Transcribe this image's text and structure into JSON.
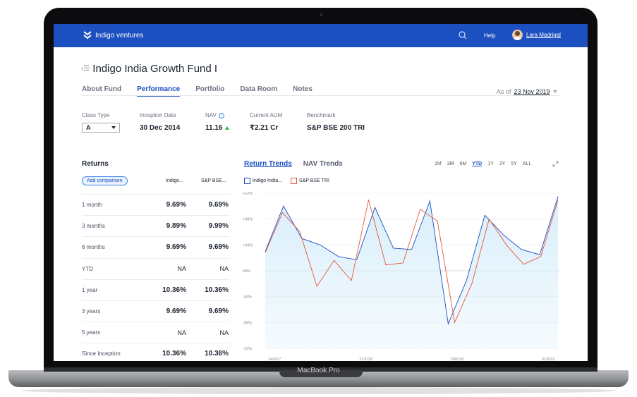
{
  "device": {
    "label": "MacBook Pro"
  },
  "topbar": {
    "brand": "Indigo ventures",
    "help": "Help",
    "user_name": "Lara Madrigal"
  },
  "page": {
    "title": "Indigo India Growth Fund I"
  },
  "tabs": [
    {
      "label": "About Fund",
      "active": false
    },
    {
      "label": "Performance",
      "active": true
    },
    {
      "label": "Portfolio",
      "active": false
    },
    {
      "label": "Data Room",
      "active": false
    },
    {
      "label": "Notes",
      "active": false
    }
  ],
  "as_of": {
    "label": "As of",
    "date": "23 Nov 2019"
  },
  "facts": {
    "class_type": {
      "label": "Class Type",
      "value": "A"
    },
    "inception": {
      "label": "Inception Date",
      "value": "30 Dec 2014"
    },
    "nav": {
      "label": "NAV",
      "value": "11.16"
    },
    "aum": {
      "label": "Current AUM",
      "value": "₹2.21 Cr"
    },
    "benchmark": {
      "label": "Benchmark",
      "value": "S&P BSE 200 TRI"
    }
  },
  "returns": {
    "title": "Returns",
    "add_comparison": "Add comparison",
    "columns": [
      "Indigo...",
      "S&P BSE..."
    ],
    "rows": [
      {
        "period": "1 month",
        "fund": "9.69%",
        "bench": "9.69%"
      },
      {
        "period": "3 months",
        "fund": "9.89%",
        "bench": "9.99%"
      },
      {
        "period": "6 months",
        "fund": "9.69%",
        "bench": "9.69%"
      },
      {
        "period": "YTD",
        "fund": "NA",
        "bench": "NA"
      },
      {
        "period": "1 year",
        "fund": "10.36%",
        "bench": "10.36%"
      },
      {
        "period": "3 years",
        "fund": "9.69%",
        "bench": "9.69%"
      },
      {
        "period": "5 years",
        "fund": "NA",
        "bench": "NA"
      },
      {
        "period": "Since Inception",
        "fund": "10.36%",
        "bench": "10.36%"
      }
    ]
  },
  "chart_tabs": [
    {
      "label": "Return Trends",
      "active": true
    },
    {
      "label": "NAV Trends",
      "active": false
    }
  ],
  "ranges": [
    "1M",
    "3M",
    "6M",
    "YTD",
    "1Y",
    "3Y",
    "5Y",
    "ALL"
  ],
  "active_range": "YTD",
  "colors": {
    "fund": "#1c4fc0",
    "bench": "#e8553a",
    "fill": "#d8eefa",
    "brand": "#1c4fc0"
  },
  "chart_data": {
    "type": "line",
    "y_ticks": [
      "+12%",
      "+08%",
      "+04%",
      "00%",
      "-04%",
      "-08%",
      "-12%"
    ],
    "ylim": [
      -12,
      12
    ],
    "x_ticks": [
      "24/9/17",
      "21/1/18",
      "30/6/18",
      "31/3/19"
    ],
    "legend": "top-left",
    "series": [
      {
        "name": "Indigo India...",
        "values": [
          3,
          10,
          5,
          4,
          2.2,
          1.7,
          9.8,
          3.5,
          3.3,
          10.8,
          -8.2,
          -1.5,
          8.6,
          5.6,
          3.3,
          2.5,
          11.5
        ]
      },
      {
        "name": "S&P BSE TRI",
        "values": [
          2.8,
          9,
          6.1,
          -2.4,
          1.6,
          -1.5,
          11,
          0.9,
          1.2,
          9.5,
          7.7,
          -8,
          -2,
          8,
          4,
          1,
          2.2,
          11
        ]
      }
    ]
  }
}
